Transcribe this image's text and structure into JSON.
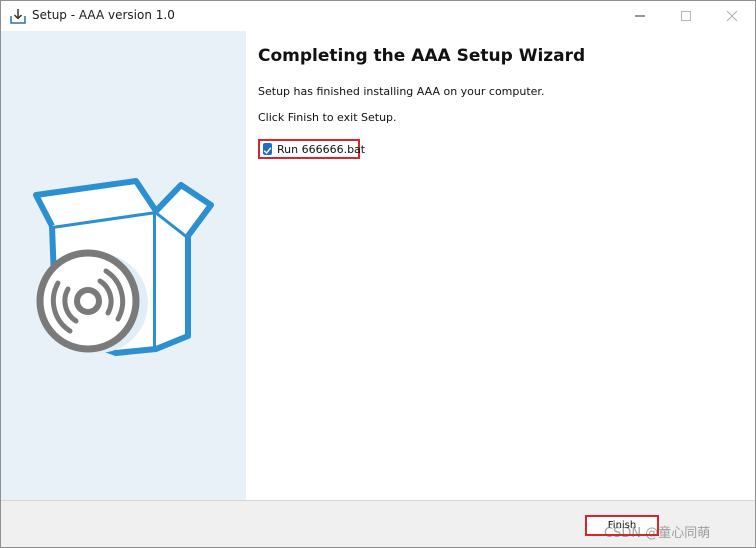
{
  "window": {
    "title": "Setup - AAA version 1.0",
    "icon": "installer-download-icon",
    "controls": {
      "minimize": "minimize-icon",
      "maximize": "maximize-icon",
      "close": "close-icon"
    }
  },
  "side_panel": {
    "illustration": "software-box-with-disc-icon"
  },
  "wizard": {
    "heading": "Completing the AAA Setup Wizard",
    "line1": "Setup has finished installing AAA on your computer.",
    "line2": "Click Finish to exit Setup.",
    "run_checkbox": {
      "label": "Run 666666.bat",
      "checked": true
    }
  },
  "footer": {
    "finish_label": "Finish",
    "watermark": "CSDN @童心同萌"
  },
  "colors": {
    "accent": "#1f6fc7",
    "highlight_border": "#d9262e",
    "side_panel": "#e8f1f8",
    "box_art": "#2b8fd0",
    "disc": "#7a7a7a"
  }
}
